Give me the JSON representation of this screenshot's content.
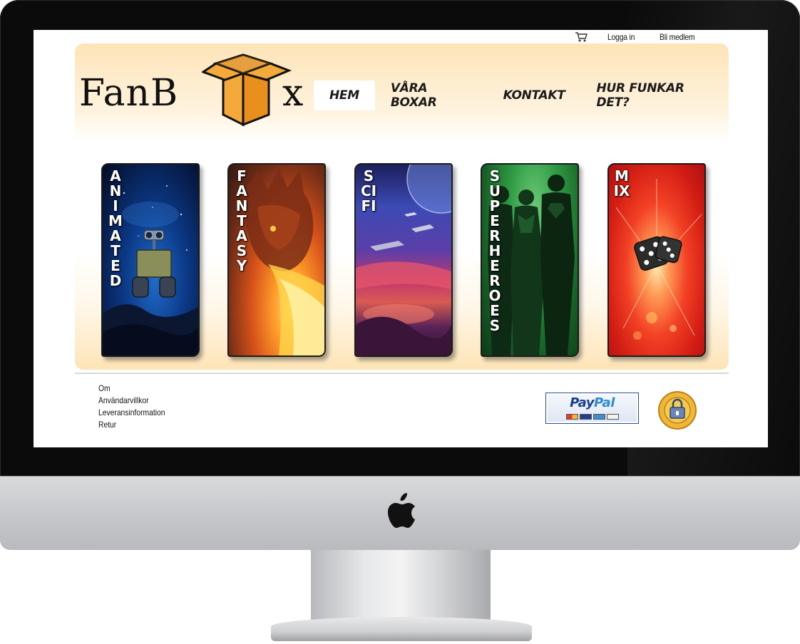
{
  "header": {
    "cart_icon": "shopping-cart-icon",
    "login_label": "Logga in",
    "signup_label": "Bli medlem"
  },
  "logo": {
    "text_left": "FanB",
    "text_right": "x"
  },
  "nav": {
    "items": [
      {
        "label": "HEM",
        "active": true
      },
      {
        "label": "VÅRA BOXAR",
        "active": false
      },
      {
        "label": "KONTAKT",
        "active": false
      },
      {
        "label": "HUR FUNKAR DET?",
        "active": false
      }
    ]
  },
  "categories": [
    {
      "label": "ANIMATED"
    },
    {
      "label": "FANTASY"
    },
    {
      "label": "SCI FI"
    },
    {
      "label": "SUPERHEROES"
    },
    {
      "label": "MIX"
    }
  ],
  "footer": {
    "links": [
      "Om",
      "Användarvillkor",
      "Leveransinformation",
      "Retur"
    ],
    "paypal": {
      "pay": "Pay",
      "pal": "Pal"
    },
    "trust_badge_icon": "trygg-e-handel-badge-icon"
  },
  "colors": {
    "panel_gradient_top": "#fde4b8",
    "box_orange": "#f4a93b",
    "paypal_dark": "#1b3f8b",
    "paypal_light": "#2d8bd1"
  }
}
